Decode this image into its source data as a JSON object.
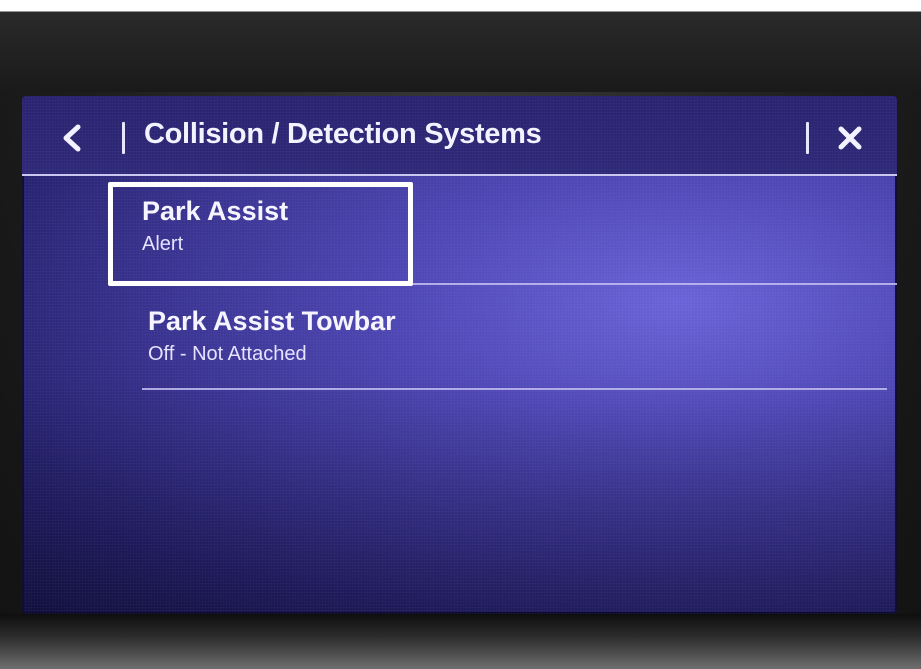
{
  "header": {
    "title": "Collision / Detection Systems",
    "back_icon": "chevron-left-icon",
    "close_icon": "close-icon"
  },
  "list": {
    "items": [
      {
        "title": "Park Assist",
        "subtitle": "Alert",
        "highlighted": true
      },
      {
        "title": "Park Assist Towbar",
        "subtitle": "Off - Not Attached",
        "highlighted": false
      }
    ]
  },
  "colors": {
    "screen_bg": "#3a3492",
    "text": "#f6f5ff",
    "highlight_border": "#ffffff"
  }
}
